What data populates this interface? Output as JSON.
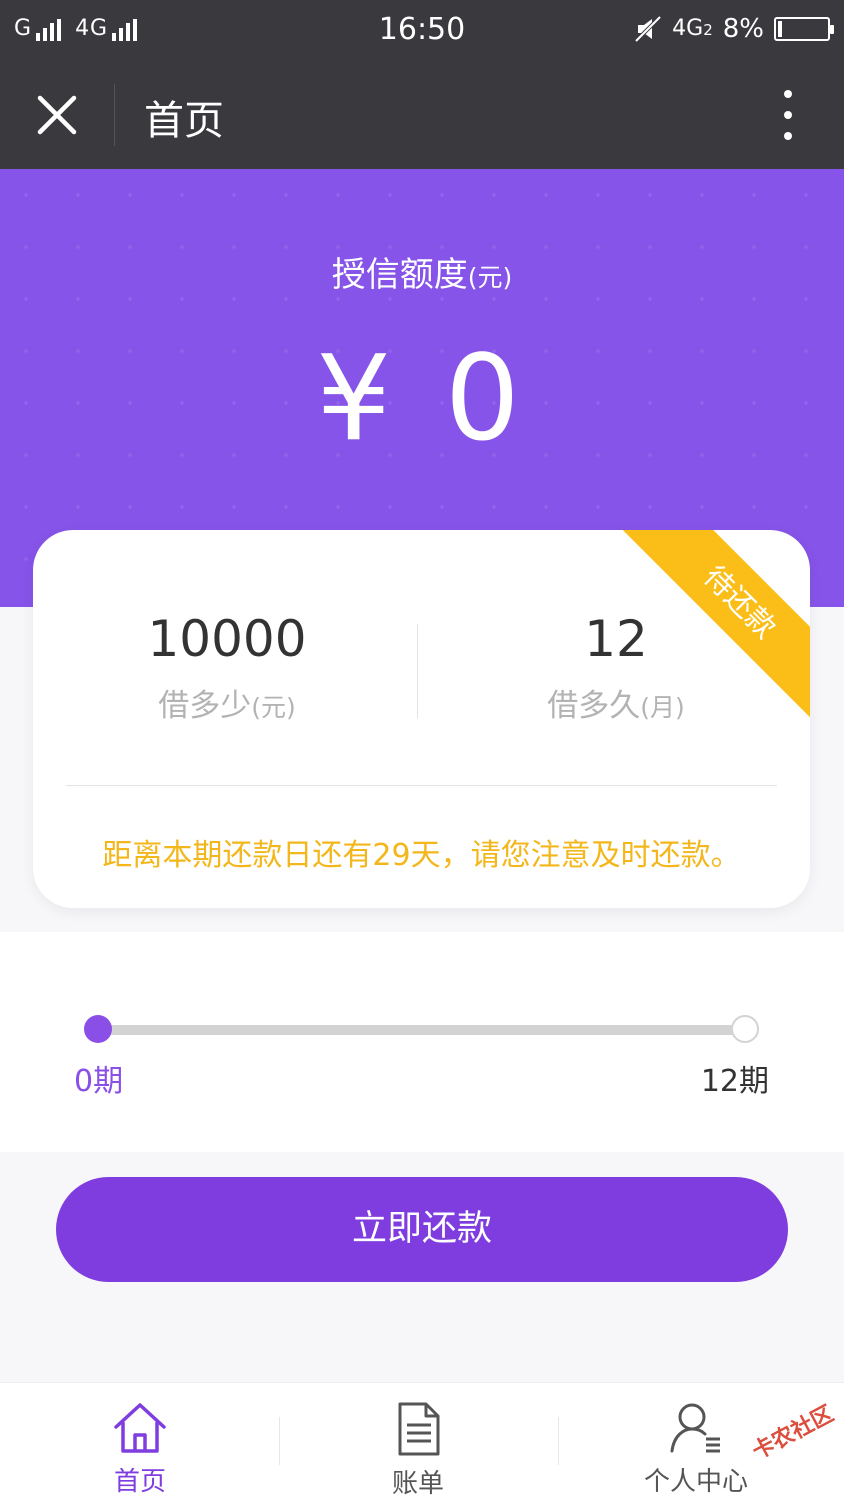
{
  "status_bar": {
    "carrier_left": "G",
    "network": "4G",
    "time": "16:50",
    "network_right": "4G",
    "sim_index": "2",
    "battery": "8%"
  },
  "nav": {
    "title": "首页"
  },
  "hero": {
    "label": "授信额度",
    "unit": "(元)",
    "amount": "¥ 0",
    "color": "#8654e8"
  },
  "card": {
    "amount": "10000",
    "amount_label": "借多少",
    "amount_unit": "(元)",
    "term": "12",
    "term_label": "借多久",
    "term_unit": "(月)",
    "ribbon": "待还款",
    "ribbon_color": "#fbbd17",
    "notice": "距离本期还款日还有29天，请您注意及时还款。"
  },
  "progress": {
    "start_label": "0期",
    "end_label": "12期",
    "paid": 0,
    "total": 12
  },
  "action": {
    "pay_label": "立即还款",
    "color": "#7f3de0"
  },
  "tabbar": {
    "items": [
      {
        "label": "首页",
        "icon": "home-icon",
        "active": true
      },
      {
        "label": "账单",
        "icon": "bill-icon",
        "active": false
      },
      {
        "label": "个人中心",
        "icon": "user-icon",
        "active": false
      }
    ]
  },
  "watermark": "卡农社区"
}
